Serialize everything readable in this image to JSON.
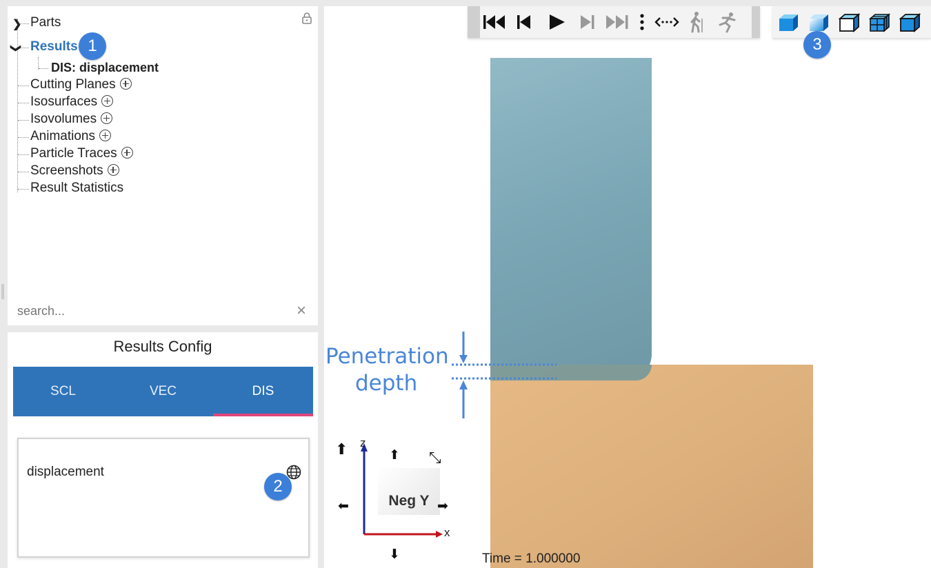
{
  "tree": {
    "lock_icon": "lock-icon",
    "items": [
      {
        "label": "Parts"
      },
      {
        "label": "Results"
      },
      {
        "label": "DIS: displacement"
      },
      {
        "label": "Cutting Planes"
      },
      {
        "label": "Isosurfaces"
      },
      {
        "label": "Isovolumes"
      },
      {
        "label": "Animations"
      },
      {
        "label": "Particle Traces"
      },
      {
        "label": "Screenshots"
      },
      {
        "label": "Result Statistics"
      }
    ],
    "search_placeholder": "search...",
    "clear_symbol": "×"
  },
  "config": {
    "title": "Results Config",
    "tabs": [
      "SCL",
      "VEC",
      "DIS"
    ],
    "active_tab": "DIS",
    "field_name": "displacement"
  },
  "badges": [
    "1",
    "2",
    "3"
  ],
  "viewport": {
    "annotation_line1": "Penetration",
    "annotation_line2": "depth",
    "view_label": "Neg Y",
    "axis_z": "z",
    "axis_x": "x",
    "time_label": "Time = 1.000000"
  },
  "colors": {
    "accent": "#3b7fd9",
    "tab_bar": "#2f74b9",
    "tab_underline": "#e0457b",
    "punch": "#7ea9b7",
    "block": "#ddb07c",
    "annotation": "#4a86d8"
  }
}
